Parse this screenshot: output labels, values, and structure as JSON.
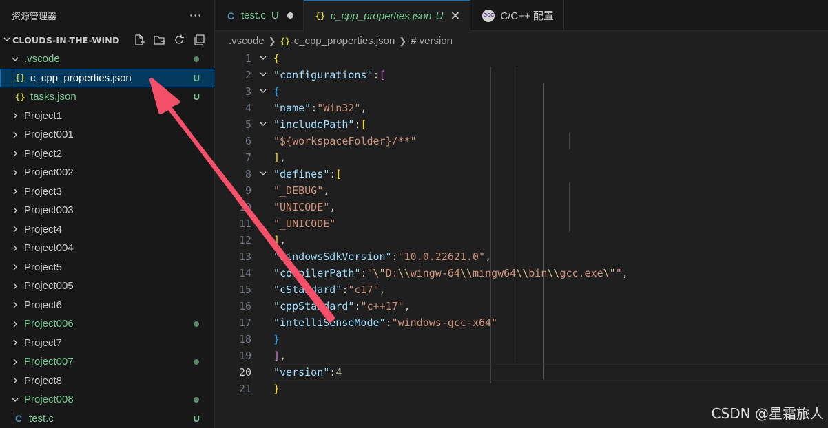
{
  "explorer": {
    "title": "资源管理器",
    "more": "···",
    "root": "CLOUDS-IN-THE-WIND",
    "items": [
      {
        "label": ".vscode",
        "type": "folder-open",
        "status": "dot",
        "color": "green"
      },
      {
        "label": "c_cpp_properties.json",
        "type": "json",
        "status": "U",
        "selected": true
      },
      {
        "label": "tasks.json",
        "type": "json",
        "status": "U"
      },
      {
        "label": "Project1",
        "type": "folder"
      },
      {
        "label": "Project001",
        "type": "folder"
      },
      {
        "label": "Project2",
        "type": "folder"
      },
      {
        "label": "Project002",
        "type": "folder"
      },
      {
        "label": "Project3",
        "type": "folder"
      },
      {
        "label": "Project003",
        "type": "folder"
      },
      {
        "label": "Project4",
        "type": "folder"
      },
      {
        "label": "Project004",
        "type": "folder"
      },
      {
        "label": "Project5",
        "type": "folder"
      },
      {
        "label": "Project005",
        "type": "folder"
      },
      {
        "label": "Project6",
        "type": "folder"
      },
      {
        "label": "Project006",
        "type": "folder",
        "status": "dot",
        "color": "green"
      },
      {
        "label": "Project7",
        "type": "folder"
      },
      {
        "label": "Project007",
        "type": "folder",
        "status": "dot",
        "color": "green"
      },
      {
        "label": "Project8",
        "type": "folder"
      },
      {
        "label": "Project008",
        "type": "folder-open",
        "status": "dot",
        "color": "green"
      },
      {
        "label": "test.c",
        "type": "c",
        "status": "U"
      }
    ]
  },
  "tabs": [
    {
      "icon": "C",
      "label": "test.c",
      "status": "U",
      "dirty": true
    },
    {
      "icon": "{}",
      "label": "c_cpp_properties.json",
      "status": "U",
      "active": true
    },
    {
      "icon": "gcc",
      "icon_text": "GCC",
      "label": "C/C++ 配置"
    }
  ],
  "breadcrumb": [
    ".vscode",
    "c_cpp_properties.json",
    "version"
  ],
  "editor": {
    "current_line": 20,
    "lines": [
      {
        "n": "1",
        "fold": "v"
      },
      {
        "n": "2",
        "fold": "v"
      },
      {
        "n": "3",
        "fold": "v"
      },
      {
        "n": "4"
      },
      {
        "n": "5",
        "fold": "v"
      },
      {
        "n": "6"
      },
      {
        "n": "7"
      },
      {
        "n": "8",
        "fold": "v"
      },
      {
        "n": "9"
      },
      {
        "n": "10"
      },
      {
        "n": "11"
      },
      {
        "n": "12"
      },
      {
        "n": "13"
      },
      {
        "n": "14"
      },
      {
        "n": "15"
      },
      {
        "n": "16"
      },
      {
        "n": "17"
      },
      {
        "n": "18"
      },
      {
        "n": "19"
      },
      {
        "n": "20"
      },
      {
        "n": "21"
      }
    ],
    "code": {
      "configurations": "\"configurations\"",
      "name_key": "\"name\"",
      "name_val": "\"Win32\"",
      "include_key": "\"includePath\"",
      "include_val": "\"${workspaceFolder}/**\"",
      "defines_key": "\"defines\"",
      "def1": "\"_DEBUG\"",
      "def2": "\"UNICODE\"",
      "def3": "\"_UNICODE\"",
      "sdk_key": "\"windowsSdkVersion\"",
      "sdk_val": "\"10.0.22621.0\"",
      "compiler_key": "\"compilerPath\"",
      "compiler_q1": "\"",
      "compiler_e1": "\\\"",
      "compiler_p1": "D:",
      "compiler_e2": "\\\\",
      "compiler_p2": "wingw-64",
      "compiler_e3": "\\\\",
      "compiler_p3": "mingw64",
      "compiler_e4": "\\\\",
      "compiler_p4": "bin",
      "compiler_e5": "\\\\",
      "compiler_p5": "gcc.exe",
      "compiler_e6": "\\\"",
      "compiler_q2": "\"",
      "cstd_key": "\"cStandard\"",
      "cstd_val": "\"c17\"",
      "cppstd_key": "\"cppStandard\"",
      "cppstd_val": "\"c++17\"",
      "intelli_key": "\"intelliSenseMode\"",
      "intelli_val": "\"windows-gcc-x64\"",
      "version_key": "\"version\"",
      "version_val": "4"
    }
  },
  "watermark": "CSDN @星霜旅人",
  "colors": {
    "accent": "#0078d4",
    "git_untracked": "#73c991",
    "arrow": "#f4506a"
  }
}
